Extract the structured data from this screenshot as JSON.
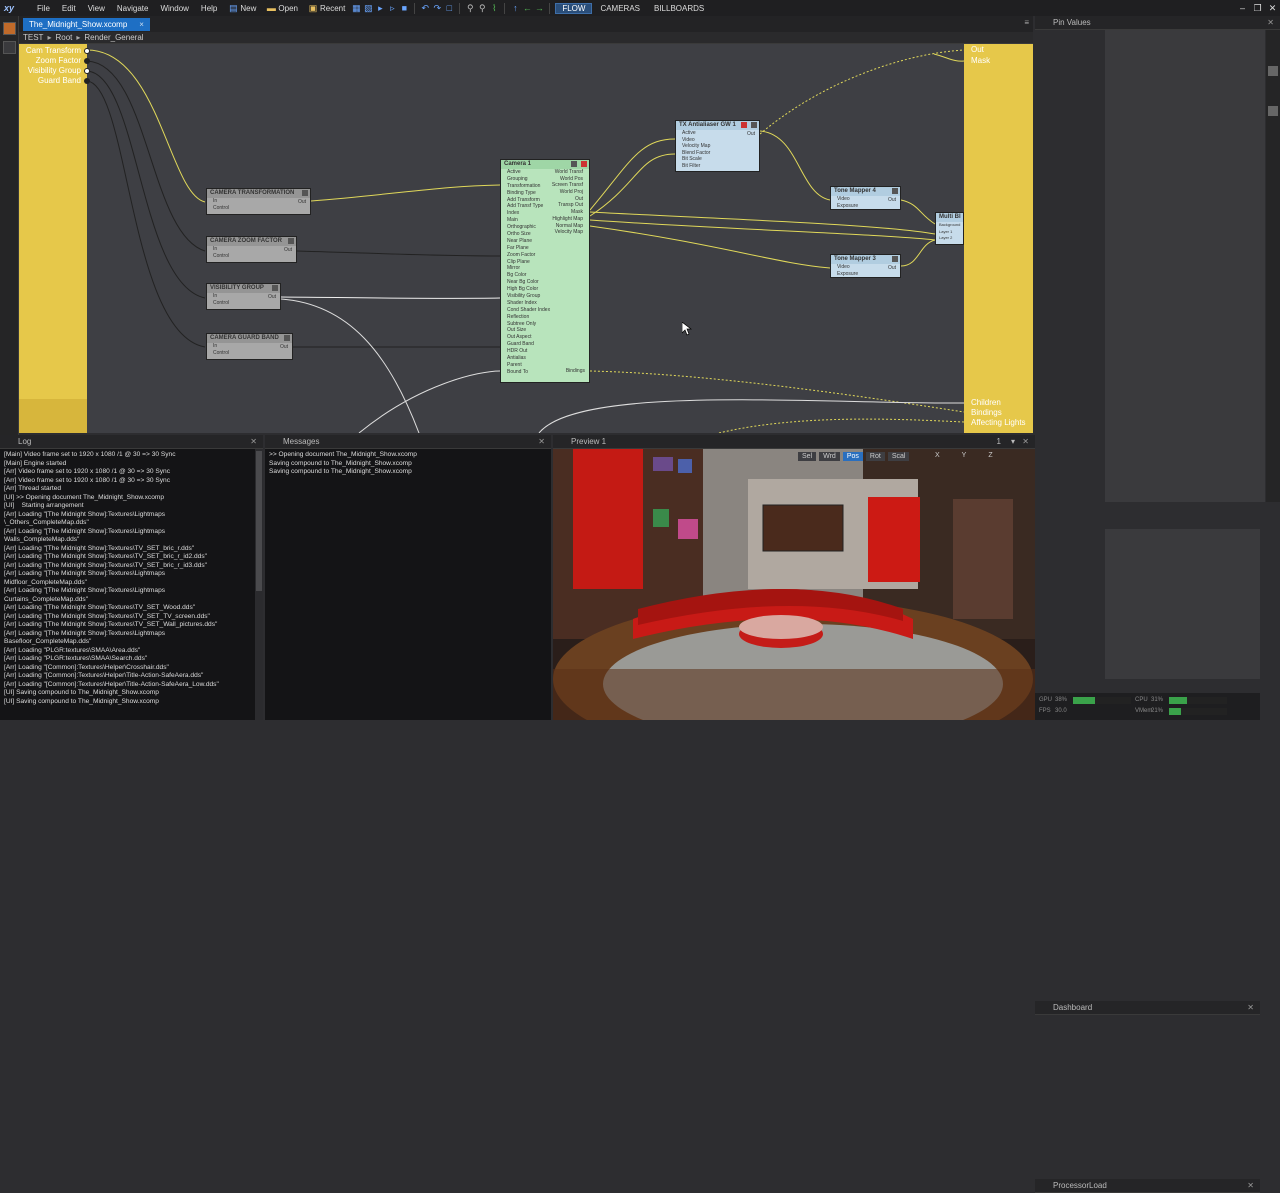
{
  "app": {
    "logo": "xy"
  },
  "menu": [
    "File",
    "Edit",
    "View",
    "Navigate",
    "Window",
    "Help"
  ],
  "toolbar": {
    "new": "New",
    "open": "Open",
    "recent": "Recent"
  },
  "modes": [
    "FLOW",
    "CAMERAS",
    "BILLBOARDS"
  ],
  "doc_tab": {
    "title": "The_Midnight_Show.xcomp",
    "close": "×"
  },
  "breadcrumb": [
    "TEST",
    "Root",
    "Render_General"
  ],
  "graph": {
    "inputs": [
      "Cam Transform",
      "Zoom Factor",
      "Visibility Group",
      "Guard Band"
    ],
    "outputs_top": [
      "Out",
      "Mask"
    ],
    "outputs_bottom": [
      "Children",
      "Bindings",
      "Affecting Lights"
    ],
    "nodes": {
      "cam_transformation": {
        "title": "CAMERA TRANSFORMATION",
        "rows": [
          "In",
          "Control"
        ],
        "out": "Out"
      },
      "cam_zoom": {
        "title": "CAMERA ZOOM FACTOR",
        "rows": [
          "In",
          "Control"
        ],
        "out": "Out"
      },
      "vis_group": {
        "title": "VISIBILITY GROUP",
        "rows": [
          "In",
          "Control"
        ],
        "out": "Out"
      },
      "guard_band": {
        "title": "CAMERA GUARD BAND",
        "rows": [
          "In",
          "Control"
        ],
        "out": "Out"
      },
      "camera1": {
        "title": "Camera 1",
        "inputs": [
          "Active",
          "Grouping",
          "Transformation",
          "Binding Type",
          "Add Transform",
          "Add Transf Type",
          "Index",
          "Main",
          "Orthographic",
          "Ortho Size",
          "Near Plane",
          "Far Plane",
          "Zoom Factor",
          "Clip Plane",
          "Mirror",
          "Bg Color",
          "Near Bg Color",
          "High Bg Color",
          "Visibility Group",
          "Shader Index",
          "Cond Shader Index",
          "Reflection",
          "Subtree Only",
          "Out Size",
          "Out Aspect",
          "Guard Band",
          "HDR Out",
          "Antialias",
          "Parent",
          "Bound To"
        ],
        "outputs": [
          "World Transf",
          "World Pos",
          "Screen Transf",
          "World Proj",
          "Out",
          "Transp Out",
          "Mask",
          "Highlight Map",
          "Normal Map",
          "Velocity Map"
        ],
        "bottom_out": "Bindings"
      },
      "tx_antialiaser": {
        "title": "TX Antialiaser GW 1",
        "rows": [
          "Active",
          "Video",
          "Velocity Map",
          "Blend Factor",
          "Bit Scale",
          "Bit Filter"
        ],
        "out": "Out"
      },
      "tone_mapper4": {
        "title": "Tone Mapper 4",
        "rows": [
          "Video",
          "Exposure"
        ],
        "out": "Out"
      },
      "tone_mapper3": {
        "title": "Tone Mapper 3",
        "rows": [
          "Video",
          "Exposure"
        ],
        "out": "Out"
      },
      "multi_blend": {
        "title": "Multi Bl",
        "rows": [
          "Background",
          "Layer 1",
          "Layer 2"
        ]
      }
    }
  },
  "panels": {
    "log": "Log",
    "messages": "Messages",
    "preview": "Preview 1",
    "pin_values": "Pin Values",
    "dashboard": "Dashboard",
    "processor_load": "ProcessorLoad"
  },
  "log_lines": [
    "[Main] Video frame set to 1920 x 1080 /1 @ 30 => 30 Sync",
    "[Main] Engine started",
    "[Arr] Video frame set to 1920 x 1080 /1 @ 30 => 30 Sync",
    "[Arr] Video frame set to 1920 x 1080 /1 @ 30 => 30 Sync",
    "[Arr] Thread started",
    "[UI] >> Opening document The_Midnight_Show.xcomp",
    "[UI]    Starting arrangement",
    "[Arr] Loading \"[The Midnight Show]:Textures\\Lightmaps",
    "\\_Others_CompleteMap.dds\"",
    "[Arr] Loading \"[The Midnight Show]:Textures\\Lightmaps",
    "Walls_CompleteMap.dds\"",
    "[Arr] Loading \"[The Midnight Show]:Textures\\TV_SET_bric_r.dds\"",
    "[Arr] Loading \"[The Midnight Show]:Textures\\TV_SET_bric_r_id2.dds\"",
    "[Arr] Loading \"[The Midnight Show]:Textures\\TV_SET_bric_r_id3.dds\"",
    "[Arr] Loading \"[The Midnight Show]:Textures\\Lightmaps",
    "Midfloor_CompleteMap.dds\"",
    "[Arr] Loading \"[The Midnight Show]:Textures\\Lightmaps",
    "Curtains_CompleteMap.dds\"",
    "[Arr] Loading \"[The Midnight Show]:Textures\\TV_SET_Wood.dds\"",
    "[Arr] Loading \"[The Midnight Show]:Textures\\TV_SET_TV_screen.dds\"",
    "[Arr] Loading \"[The Midnight Show]:Textures\\TV_SET_Wall_pictures.dds\"",
    "[Arr] Loading \"[The Midnight Show]:Textures\\Lightmaps",
    "Basefloor_CompleteMap.dds\"",
    "[Arr] Loading \"PLGR:textures\\SMAA\\Area.dds\"",
    "[Arr] Loading \"PLGR:textures\\SMAA\\Search.dds\"",
    "[Arr] Loading \"[Common]:Textures\\Helper\\Crosshair.dds\"",
    "[Arr] Loading \"[Common]:Textures\\Helper\\Title-Action-SafeAera.dds\"",
    "[Arr] Loading \"[Common]:Textures\\Helper\\Title-Action-SafeAera_Low.dds\"",
    "[UI] Saving compound to The_Midnight_Show.xcomp",
    "[UI] Saving compound to The_Midnight_Show.xcomp"
  ],
  "messages": [
    ">> Opening document The_Midnight_Show.xcomp",
    "Saving compound to The_Midnight_Show.xcomp",
    "Saving compound to The_Midnight_Show.xcomp"
  ],
  "preview_tools": [
    "Sel",
    "Wrd",
    "Pos",
    "Rot",
    "Scal"
  ],
  "preview_axes": [
    "X",
    "Y",
    "Z"
  ],
  "preview_index": "1",
  "processor": {
    "gpu_label": "GPU",
    "gpu_val": "38%",
    "gpu_frac": 0.38,
    "fps_label": "FPS",
    "fps_val": "30.0",
    "cpu_label": "CPU",
    "cpu_val": "31%",
    "cpu_frac": 0.31,
    "vmem_label": "VMem",
    "vmem_val": "21%",
    "vmem_frac": 0.21
  }
}
